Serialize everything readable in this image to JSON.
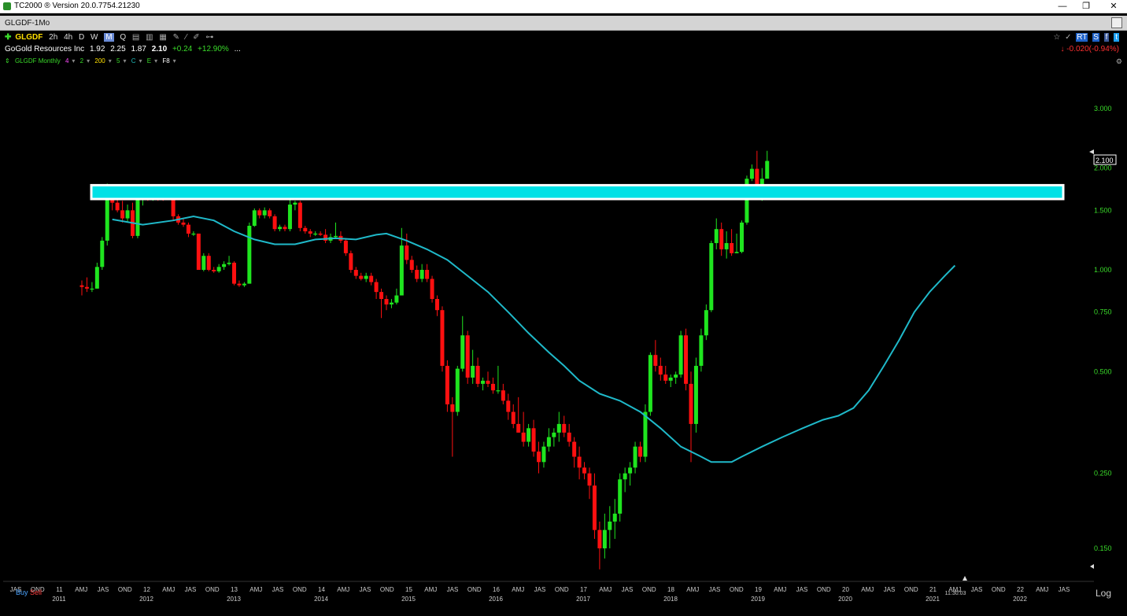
{
  "window": {
    "title": "TC2000 ® Version 20.0.7754.21230",
    "buttons": [
      "—",
      "❐",
      "✕"
    ]
  },
  "tab": {
    "label": "GLGDF-1Mo"
  },
  "toolbar": {
    "symbol": "GLGDF",
    "timeframes": [
      "2h",
      "4h",
      "D",
      "W",
      "M",
      "Q"
    ],
    "active_timeframe": "M"
  },
  "quote": {
    "company": "GoGold Resources Inc",
    "open": "1.92",
    "high": "2.25",
    "low": "1.87",
    "last": "2.10",
    "change": "+0.24",
    "change_pct": "+12.90%",
    "more": "...",
    "after_change": "-0.020(-0.94%)"
  },
  "indicators": {
    "label": "GLGDF Monthly",
    "settings": [
      "4",
      "2",
      "200",
      "5",
      "C",
      "E",
      "F8"
    ],
    "colors": [
      "#ff4dff",
      "#3adb2a",
      "#ffe000",
      "#3adb2a",
      "#1fb9b9",
      "#3adb2a",
      "#ffffff"
    ]
  },
  "right_panel": {
    "icons": [
      "☆",
      "✓",
      "RT",
      "S",
      "f",
      "t"
    ]
  },
  "footer": {
    "buy": "Buy",
    "sell": "Sell",
    "scale": "Log",
    "clock": "11:30:03"
  },
  "chart_data": {
    "type": "candlestick",
    "scale": "log",
    "y_ticks": [
      3.0,
      2.0,
      1.5,
      1.0,
      0.75,
      0.5,
      0.25,
      0.15
    ],
    "y_tick_labels": [
      "3.000",
      "2.000",
      "1.500",
      "1.000",
      "0.750",
      "0.500",
      "0.250",
      "0.150"
    ],
    "last_price_label": "2.100",
    "resistance_zone": {
      "low": 1.62,
      "high": 1.78,
      "color": "#00e1e6"
    },
    "moving_average_color": "#1fb9c9",
    "x_axis": {
      "quarter_labels": [
        "JAS",
        "OND",
        "11",
        "AMJ",
        "JAS",
        "OND",
        "12",
        "AMJ",
        "JAS",
        "OND",
        "13",
        "AMJ",
        "JAS",
        "OND",
        "14",
        "AMJ",
        "JAS",
        "OND",
        "15",
        "AMJ",
        "JAS",
        "OND",
        "16",
        "AMJ",
        "JAS",
        "OND",
        "17",
        "AMJ",
        "JAS",
        "OND",
        "18",
        "AMJ",
        "JAS",
        "OND",
        "19",
        "AMJ",
        "JAS",
        "OND",
        "20",
        "AMJ",
        "JAS",
        "OND",
        "21",
        "AMJ",
        "JAS",
        "OND",
        "22",
        "AMJ",
        "JAS"
      ],
      "year_labels": [
        "2011",
        "2012",
        "2013",
        "2014",
        "2015",
        "2016",
        "2017",
        "2018",
        "2019",
        "2020",
        "2021",
        "2022"
      ]
    },
    "candles": [
      [
        0.9,
        0.93,
        0.84,
        0.89
      ],
      [
        0.89,
        0.95,
        0.86,
        0.88
      ],
      [
        0.88,
        0.92,
        0.86,
        0.88
      ],
      [
        0.88,
        1.05,
        0.88,
        1.02
      ],
      [
        1.02,
        1.25,
        1.0,
        1.22
      ],
      [
        1.22,
        1.8,
        1.18,
        1.62
      ],
      [
        1.62,
        1.72,
        1.5,
        1.58
      ],
      [
        1.58,
        1.65,
        1.48,
        1.5
      ],
      [
        1.5,
        1.6,
        1.38,
        1.42
      ],
      [
        1.42,
        1.56,
        1.38,
        1.5
      ],
      [
        1.5,
        1.58,
        1.24,
        1.26
      ],
      [
        1.26,
        1.65,
        1.24,
        1.62
      ],
      [
        1.62,
        1.72,
        1.55,
        1.66
      ],
      [
        1.66,
        1.7,
        1.6,
        1.64
      ],
      [
        1.64,
        1.7,
        1.6,
        1.65
      ],
      [
        1.65,
        1.7,
        1.6,
        1.64
      ],
      [
        1.64,
        1.7,
        1.6,
        1.63
      ],
      [
        1.63,
        1.72,
        1.62,
        1.66
      ],
      [
        1.66,
        1.68,
        1.4,
        1.44
      ],
      [
        1.44,
        1.46,
        1.36,
        1.38
      ],
      [
        1.38,
        1.42,
        1.34,
        1.36
      ],
      [
        1.36,
        1.38,
        1.25,
        1.28
      ],
      [
        1.28,
        1.3,
        1.26,
        1.28
      ],
      [
        1.28,
        1.28,
        1.0,
        1.0
      ],
      [
        1.0,
        1.12,
        0.99,
        1.1
      ],
      [
        1.1,
        1.12,
        0.99,
        1.0
      ],
      [
        1.0,
        1.02,
        0.98,
        0.99
      ],
      [
        0.99,
        1.04,
        0.98,
        1.02
      ],
      [
        1.02,
        1.06,
        1.0,
        1.04
      ],
      [
        1.04,
        1.1,
        1.03,
        1.05
      ],
      [
        1.05,
        1.06,
        0.9,
        0.91
      ],
      [
        0.91,
        0.93,
        0.89,
        0.9
      ],
      [
        0.9,
        0.92,
        0.89,
        0.91
      ],
      [
        0.91,
        1.38,
        0.91,
        1.35
      ],
      [
        1.35,
        1.52,
        1.34,
        1.5
      ],
      [
        1.5,
        1.52,
        1.42,
        1.45
      ],
      [
        1.45,
        1.53,
        1.42,
        1.5
      ],
      [
        1.5,
        1.52,
        1.42,
        1.44
      ],
      [
        1.44,
        1.46,
        1.3,
        1.32
      ],
      [
        1.32,
        1.36,
        1.3,
        1.34
      ],
      [
        1.34,
        1.36,
        1.3,
        1.32
      ],
      [
        1.32,
        1.64,
        1.3,
        1.56
      ],
      [
        1.56,
        1.6,
        1.5,
        1.58
      ],
      [
        1.58,
        1.6,
        1.3,
        1.33
      ],
      [
        1.33,
        1.35,
        1.28,
        1.3
      ],
      [
        1.3,
        1.32,
        1.25,
        1.28
      ],
      [
        1.28,
        1.3,
        1.26,
        1.28
      ],
      [
        1.28,
        1.3,
        1.26,
        1.27
      ],
      [
        1.27,
        1.32,
        1.2,
        1.22
      ],
      [
        1.22,
        1.28,
        1.2,
        1.25
      ],
      [
        1.25,
        1.38,
        1.24,
        1.26
      ],
      [
        1.26,
        1.3,
        1.2,
        1.22
      ],
      [
        1.22,
        1.24,
        1.1,
        1.12
      ],
      [
        1.12,
        1.14,
        0.98,
        1.0
      ],
      [
        1.0,
        1.02,
        0.94,
        0.96
      ],
      [
        0.96,
        0.98,
        0.93,
        0.94
      ],
      [
        0.94,
        0.98,
        0.92,
        0.96
      ],
      [
        0.96,
        0.98,
        0.9,
        0.92
      ],
      [
        0.92,
        0.94,
        0.82,
        0.86
      ],
      [
        0.86,
        0.88,
        0.72,
        0.82
      ],
      [
        0.82,
        0.84,
        0.76,
        0.79
      ],
      [
        0.79,
        0.82,
        0.77,
        0.8
      ],
      [
        0.8,
        0.88,
        0.79,
        0.84
      ],
      [
        0.84,
        1.33,
        0.84,
        1.18
      ],
      [
        1.18,
        1.28,
        1.04,
        1.07
      ],
      [
        1.07,
        1.1,
        0.98,
        1.0
      ],
      [
        1.0,
        1.03,
        0.92,
        0.94
      ],
      [
        0.94,
        1.04,
        0.92,
        1.0
      ],
      [
        1.0,
        1.04,
        0.92,
        0.94
      ],
      [
        0.94,
        0.96,
        0.8,
        0.82
      ],
      [
        0.82,
        0.84,
        0.73,
        0.76
      ],
      [
        0.76,
        0.78,
        0.5,
        0.52
      ],
      [
        0.52,
        0.54,
        0.38,
        0.4
      ],
      [
        0.4,
        0.42,
        0.28,
        0.38
      ],
      [
        0.38,
        0.52,
        0.37,
        0.51
      ],
      [
        0.51,
        0.73,
        0.5,
        0.64
      ],
      [
        0.64,
        0.66,
        0.46,
        0.48
      ],
      [
        0.48,
        0.58,
        0.46,
        0.52
      ],
      [
        0.52,
        0.55,
        0.45,
        0.46
      ],
      [
        0.46,
        0.48,
        0.44,
        0.47
      ],
      [
        0.47,
        0.5,
        0.45,
        0.46
      ],
      [
        0.46,
        0.48,
        0.43,
        0.44
      ],
      [
        0.44,
        0.52,
        0.43,
        0.44
      ],
      [
        0.44,
        0.46,
        0.4,
        0.41
      ],
      [
        0.41,
        0.43,
        0.36,
        0.38
      ],
      [
        0.38,
        0.4,
        0.34,
        0.35
      ],
      [
        0.35,
        0.42,
        0.33,
        0.33
      ],
      [
        0.33,
        0.38,
        0.3,
        0.31
      ],
      [
        0.31,
        0.35,
        0.3,
        0.34
      ],
      [
        0.34,
        0.36,
        0.28,
        0.29
      ],
      [
        0.29,
        0.31,
        0.25,
        0.27
      ],
      [
        0.27,
        0.31,
        0.26,
        0.3
      ],
      [
        0.3,
        0.34,
        0.29,
        0.32
      ],
      [
        0.32,
        0.34,
        0.3,
        0.33
      ],
      [
        0.33,
        0.38,
        0.31,
        0.35
      ],
      [
        0.35,
        0.37,
        0.32,
        0.33
      ],
      [
        0.33,
        0.35,
        0.3,
        0.31
      ],
      [
        0.31,
        0.32,
        0.26,
        0.28
      ],
      [
        0.28,
        0.3,
        0.24,
        0.26
      ],
      [
        0.26,
        0.27,
        0.24,
        0.25
      ],
      [
        0.25,
        0.26,
        0.21,
        0.23
      ],
      [
        0.23,
        0.25,
        0.16,
        0.17
      ],
      [
        0.17,
        0.18,
        0.13,
        0.15
      ],
      [
        0.15,
        0.19,
        0.14,
        0.17
      ],
      [
        0.17,
        0.2,
        0.15,
        0.18
      ],
      [
        0.18,
        0.21,
        0.16,
        0.19
      ],
      [
        0.19,
        0.25,
        0.18,
        0.24
      ],
      [
        0.24,
        0.26,
        0.22,
        0.25
      ],
      [
        0.25,
        0.27,
        0.23,
        0.26
      ],
      [
        0.26,
        0.31,
        0.25,
        0.3
      ],
      [
        0.3,
        0.31,
        0.27,
        0.28
      ],
      [
        0.28,
        0.4,
        0.27,
        0.38
      ],
      [
        0.38,
        0.57,
        0.37,
        0.56
      ],
      [
        0.56,
        0.62,
        0.5,
        0.52
      ],
      [
        0.52,
        0.55,
        0.47,
        0.49
      ],
      [
        0.49,
        0.52,
        0.46,
        0.47
      ],
      [
        0.47,
        0.49,
        0.45,
        0.48
      ],
      [
        0.48,
        0.5,
        0.46,
        0.49
      ],
      [
        0.49,
        0.66,
        0.48,
        0.64
      ],
      [
        0.64,
        0.67,
        0.44,
        0.46
      ],
      [
        0.46,
        0.5,
        0.27,
        0.35
      ],
      [
        0.35,
        0.55,
        0.33,
        0.52
      ],
      [
        0.52,
        0.67,
        0.5,
        0.64
      ],
      [
        0.64,
        0.79,
        0.62,
        0.76
      ],
      [
        0.76,
        1.22,
        0.75,
        1.2
      ],
      [
        1.2,
        1.42,
        1.15,
        1.32
      ],
      [
        1.32,
        1.38,
        1.1,
        1.15
      ],
      [
        1.15,
        1.3,
        1.08,
        1.2
      ],
      [
        1.2,
        1.32,
        1.1,
        1.12
      ],
      [
        1.12,
        1.28,
        1.12,
        1.13
      ],
      [
        1.13,
        1.4,
        1.12,
        1.38
      ],
      [
        1.38,
        1.9,
        1.36,
        1.86
      ],
      [
        1.86,
        2.05,
        1.83,
        1.99
      ],
      [
        1.99,
        2.25,
        1.7,
        1.75
      ],
      [
        1.75,
        2.0,
        1.6,
        1.86
      ],
      [
        1.86,
        2.25,
        1.87,
        2.1
      ]
    ],
    "moving_average": [
      [
        6,
        1.41
      ],
      [
        12,
        1.36
      ],
      [
        18,
        1.4
      ],
      [
        22,
        1.44
      ],
      [
        26,
        1.4
      ],
      [
        30,
        1.3
      ],
      [
        34,
        1.23
      ],
      [
        38,
        1.19
      ],
      [
        42,
        1.19
      ],
      [
        46,
        1.23
      ],
      [
        50,
        1.24
      ],
      [
        54,
        1.23
      ],
      [
        58,
        1.27
      ],
      [
        60,
        1.28
      ],
      [
        64,
        1.22
      ],
      [
        68,
        1.15
      ],
      [
        72,
        1.07
      ],
      [
        76,
        0.96
      ],
      [
        80,
        0.86
      ],
      [
        84,
        0.75
      ],
      [
        88,
        0.65
      ],
      [
        92,
        0.57
      ],
      [
        95,
        0.52
      ],
      [
        98,
        0.47
      ],
      [
        102,
        0.43
      ],
      [
        106,
        0.41
      ],
      [
        110,
        0.38
      ],
      [
        114,
        0.34
      ],
      [
        118,
        0.3
      ],
      [
        122,
        0.28
      ],
      [
        124,
        0.27
      ],
      [
        126,
        0.27
      ],
      [
        128,
        0.27
      ],
      [
        130,
        0.28
      ],
      [
        134,
        0.3
      ],
      [
        138,
        0.32
      ],
      [
        142,
        0.34
      ],
      [
        146,
        0.36
      ],
      [
        149,
        0.37
      ],
      [
        152,
        0.39
      ],
      [
        155,
        0.44
      ],
      [
        158,
        0.52
      ],
      [
        161,
        0.62
      ],
      [
        164,
        0.75
      ],
      [
        167,
        0.86
      ],
      [
        170,
        0.96
      ],
      [
        172,
        1.03
      ]
    ]
  }
}
